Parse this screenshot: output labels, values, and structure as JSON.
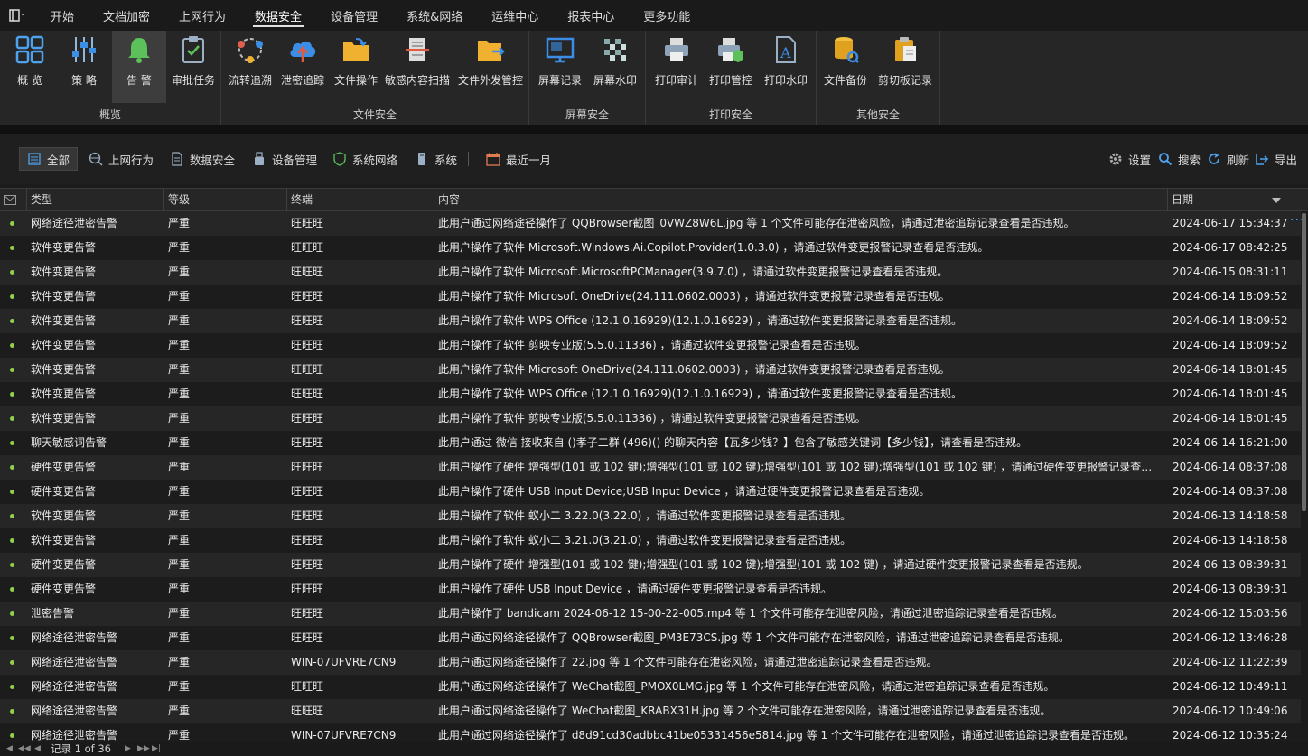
{
  "menu": {
    "items": [
      "开始",
      "文档加密",
      "上网行为",
      "数据安全",
      "设备管理",
      "系统&网络",
      "运维中心",
      "报表中心",
      "更多功能"
    ],
    "active": "数据安全"
  },
  "ribbon": {
    "groups": {
      "overview": "概览",
      "file_security": "文件安全",
      "screen_security": "屏幕安全",
      "print_security": "打印安全",
      "other_security": "其他安全"
    },
    "buttons": {
      "overview": "概 览",
      "policy": "策 略",
      "alert": "告 警",
      "approval": "审批任务",
      "flow_trace": "流转追溯",
      "leak_trace": "泄密追踪",
      "file_ops": "文件操作",
      "sensitive_scan": "敏感内容扫描",
      "file_outgoing": "文件外发管控",
      "screen_record": "屏幕记录",
      "screen_watermark": "屏幕水印",
      "print_audit": "打印审计",
      "print_control": "打印管控",
      "print_watermark": "打印水印",
      "file_backup": "文件备份",
      "clipboard_log": "剪切板记录"
    }
  },
  "filters": {
    "all": "全部",
    "web": "上网行为",
    "data": "数据安全",
    "device": "设备管理",
    "sysnet": "系统网络",
    "system": "系统",
    "range": "最近一月",
    "settings": "设置",
    "search": "搜索",
    "refresh": "刷新",
    "export": "导出"
  },
  "table": {
    "headers": {
      "type": "类型",
      "level": "等级",
      "terminal": "终端",
      "content": "内容",
      "date": "日期"
    },
    "rows": [
      {
        "type": "网络途径泄密告警",
        "level": "严重",
        "terminal": "旺旺旺",
        "content": "此用户通过网络途径操作了 QQBrowser截图_0VWZ8W6L.jpg 等 1 个文件可能存在泄密风险，请通过泄密追踪记录查看是否违规。",
        "date": "2024-06-17 15:34:37"
      },
      {
        "type": "软件变更告警",
        "level": "严重",
        "terminal": "旺旺旺",
        "content": "此用户操作了软件 Microsoft.Windows.Ai.Copilot.Provider(1.0.3.0) ，请通过软件变更报警记录查看是否违规。",
        "date": "2024-06-17 08:42:25"
      },
      {
        "type": "软件变更告警",
        "level": "严重",
        "terminal": "旺旺旺",
        "content": "此用户操作了软件 Microsoft.MicrosoftPCManager(3.9.7.0) ，请通过软件变更报警记录查看是否违规。",
        "date": "2024-06-15 08:31:11"
      },
      {
        "type": "软件变更告警",
        "level": "严重",
        "terminal": "旺旺旺",
        "content": "此用户操作了软件 Microsoft OneDrive(24.111.0602.0003) ，请通过软件变更报警记录查看是否违规。",
        "date": "2024-06-14 18:09:52"
      },
      {
        "type": "软件变更告警",
        "level": "严重",
        "terminal": "旺旺旺",
        "content": "此用户操作了软件 WPS Office (12.1.0.16929)(12.1.0.16929) ，请通过软件变更报警记录查看是否违规。",
        "date": "2024-06-14 18:09:52"
      },
      {
        "type": "软件变更告警",
        "level": "严重",
        "terminal": "旺旺旺",
        "content": "此用户操作了软件 剪映专业版(5.5.0.11336) ，请通过软件变更报警记录查看是否违规。",
        "date": "2024-06-14 18:09:52"
      },
      {
        "type": "软件变更告警",
        "level": "严重",
        "terminal": "旺旺旺",
        "content": "此用户操作了软件 Microsoft OneDrive(24.111.0602.0003) ，请通过软件变更报警记录查看是否违规。",
        "date": "2024-06-14 18:01:45"
      },
      {
        "type": "软件变更告警",
        "level": "严重",
        "terminal": "旺旺旺",
        "content": "此用户操作了软件 WPS Office (12.1.0.16929)(12.1.0.16929) ，请通过软件变更报警记录查看是否违规。",
        "date": "2024-06-14 18:01:45"
      },
      {
        "type": "软件变更告警",
        "level": "严重",
        "terminal": "旺旺旺",
        "content": "此用户操作了软件 剪映专业版(5.5.0.11336) ，请通过软件变更报警记录查看是否违规。",
        "date": "2024-06-14 18:01:45"
      },
      {
        "type": "聊天敏感词告警",
        "level": "严重",
        "terminal": "旺旺旺",
        "content": "此用户通过 微信 接收来自 ()孝子二群 (496)() 的聊天内容【瓦多少钱？】包含了敏感关键词【多少钱】，请查看是否违规。",
        "date": "2024-06-14 16:21:00"
      },
      {
        "type": "硬件变更告警",
        "level": "严重",
        "terminal": "旺旺旺",
        "content": "此用户操作了硬件 增强型(101 或 102 键);增强型(101 或 102 键);增强型(101 或 102 键);增强型(101 或 102 键) ，请通过硬件变更报警记录查看是否违规。",
        "date": "2024-06-14 08:37:08"
      },
      {
        "type": "硬件变更告警",
        "level": "严重",
        "terminal": "旺旺旺",
        "content": "此用户操作了硬件 USB Input Device;USB Input Device ，请通过硬件变更报警记录查看是否违规。",
        "date": "2024-06-14 08:37:08"
      },
      {
        "type": "软件变更告警",
        "level": "严重",
        "terminal": "旺旺旺",
        "content": "此用户操作了软件 蚁小二 3.22.0(3.22.0) ，请通过软件变更报警记录查看是否违规。",
        "date": "2024-06-13 14:18:58"
      },
      {
        "type": "软件变更告警",
        "level": "严重",
        "terminal": "旺旺旺",
        "content": "此用户操作了软件 蚁小二 3.21.0(3.21.0) ，请通过软件变更报警记录查看是否违规。",
        "date": "2024-06-13 14:18:58"
      },
      {
        "type": "硬件变更告警",
        "level": "严重",
        "terminal": "旺旺旺",
        "content": "此用户操作了硬件 增强型(101 或 102 键);增强型(101 或 102 键);增强型(101 或 102 键) ，请通过硬件变更报警记录查看是否违规。",
        "date": "2024-06-13 08:39:31"
      },
      {
        "type": "硬件变更告警",
        "level": "严重",
        "terminal": "旺旺旺",
        "content": "此用户操作了硬件 USB Input Device ，请通过硬件变更报警记录查看是否违规。",
        "date": "2024-06-13 08:39:31"
      },
      {
        "type": "泄密告警",
        "level": "严重",
        "terminal": "旺旺旺",
        "content": "此用户操作了 bandicam 2024-06-12 15-00-22-005.mp4 等 1 个文件可能存在泄密风险，请通过泄密追踪记录查看是否违规。",
        "date": "2024-06-12 15:03:56"
      },
      {
        "type": "网络途径泄密告警",
        "level": "严重",
        "terminal": "旺旺旺",
        "content": "此用户通过网络途径操作了 QQBrowser截图_PM3E73CS.jpg 等 1 个文件可能存在泄密风险，请通过泄密追踪记录查看是否违规。",
        "date": "2024-06-12 13:46:28"
      },
      {
        "type": "网络途径泄密告警",
        "level": "严重",
        "terminal": "WIN-07UFVRE7CN9",
        "content": "此用户通过网络途径操作了 22.jpg 等 1 个文件可能存在泄密风险，请通过泄密追踪记录查看是否违规。",
        "date": "2024-06-12 11:22:39"
      },
      {
        "type": "网络途径泄密告警",
        "level": "严重",
        "terminal": "旺旺旺",
        "content": "此用户通过网络途径操作了 WeChat截图_PMOX0LMG.jpg 等 1 个文件可能存在泄密风险，请通过泄密追踪记录查看是否违规。",
        "date": "2024-06-12 10:49:11"
      },
      {
        "type": "网络途径泄密告警",
        "level": "严重",
        "terminal": "旺旺旺",
        "content": "此用户通过网络途径操作了 WeChat截图_KRABX31H.jpg 等 2 个文件可能存在泄密风险，请通过泄密追踪记录查看是否违规。",
        "date": "2024-06-12 10:49:06"
      },
      {
        "type": "网络途径泄密告警",
        "level": "严重",
        "terminal": "WIN-07UFVRE7CN9",
        "content": "此用户通过网络途径操作了 d8d91cd30adbbc41be05331456e5814.jpg 等 1 个文件可能存在泄密风险，请通过泄密追踪记录查看是否违规。",
        "date": "2024-06-12 10:35:24"
      }
    ]
  },
  "status": {
    "record_label": "记录 1 of 36"
  },
  "colors": {
    "accent_blue": "#3a8ee6",
    "dot_green": "#8fd14a",
    "bell_green": "#5cc15a"
  }
}
